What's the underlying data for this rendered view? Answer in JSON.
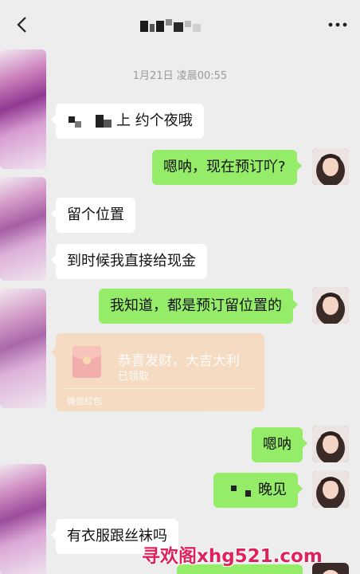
{
  "header": {
    "back_icon": "chevron-left-icon",
    "more_icon": "more-dots-icon"
  },
  "chat": {
    "timestamp": "1月21日 凌晨00:55",
    "messages": [
      {
        "side": "in",
        "text": "上 约个夜哦"
      },
      {
        "side": "out",
        "text": "嗯呐，现在预订吖?"
      },
      {
        "side": "in",
        "text": "留个位置"
      },
      {
        "side": "in",
        "text": "到时候我直接给现金"
      },
      {
        "side": "out",
        "text": "我知道，都是预订留位置的"
      },
      {
        "side": "out",
        "text": "嗯呐"
      },
      {
        "side": "out",
        "text": "晚见"
      },
      {
        "side": "in",
        "text": "有衣服跟丝袜吗"
      }
    ],
    "red_packet": {
      "title": "恭喜发财，大吉大利",
      "status": "已领取",
      "footer": "微信红包",
      "color": "#f7d8b8"
    }
  },
  "watermark": "寻欢阁xhg521.com"
}
